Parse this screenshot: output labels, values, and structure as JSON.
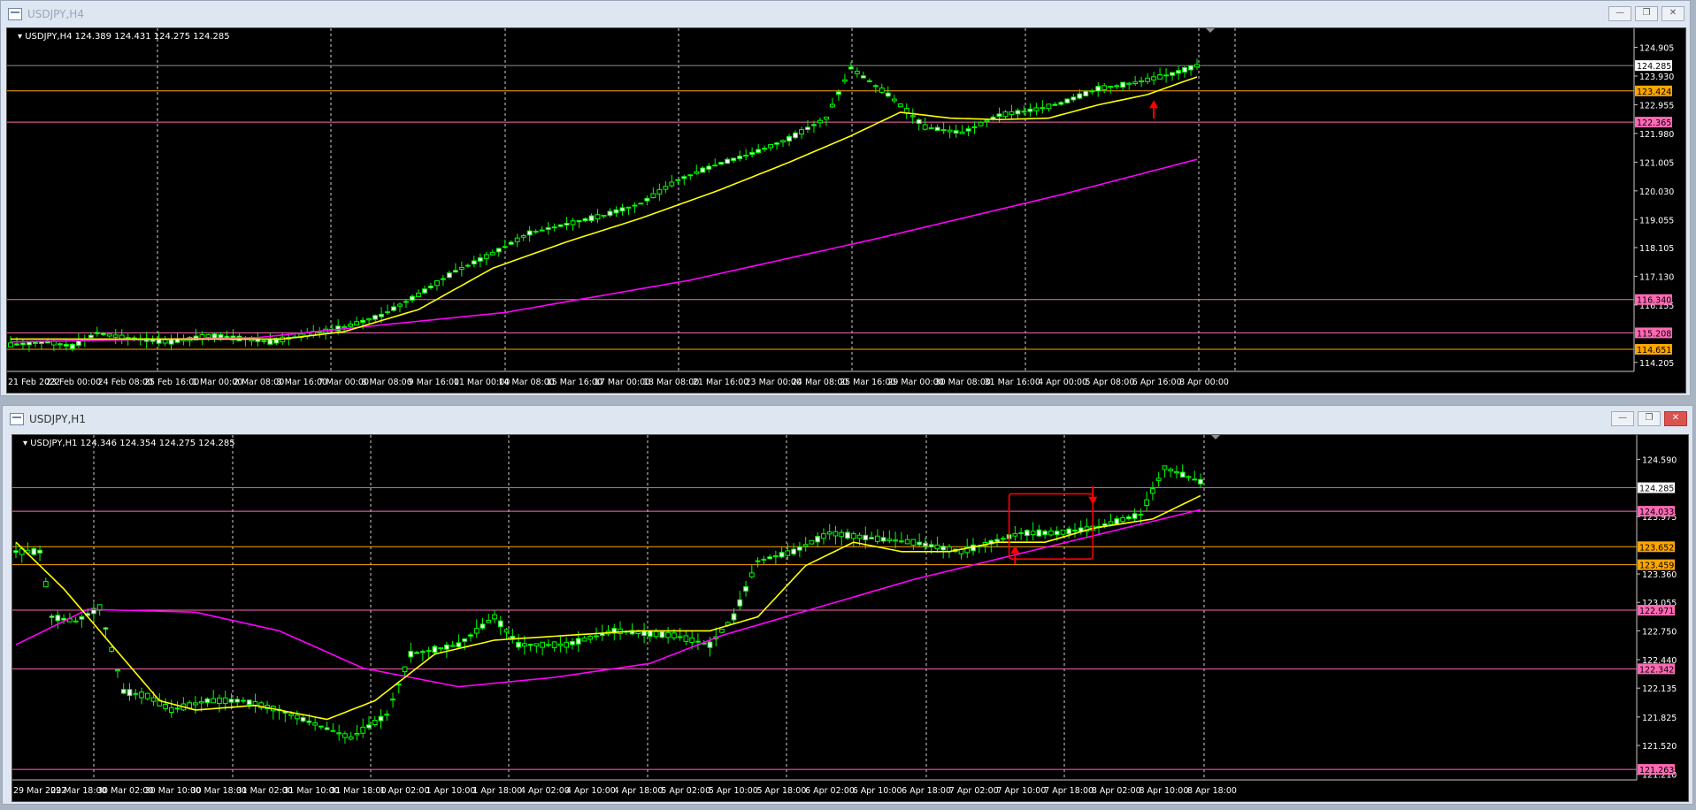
{
  "windows": [
    {
      "title": "USDJPY,H4",
      "buttons": [
        "minimize",
        "restore",
        "close"
      ]
    },
    {
      "title": "USDJPY,H1",
      "buttons": [
        "minimize",
        "restore",
        "close"
      ]
    }
  ],
  "colors": {
    "background": "#000000",
    "bull": "#00ff00",
    "ma_fast": "#ffff00",
    "ma_slow": "#ff00ff",
    "orange_level": "#ffa500",
    "pink_level": "#ff69b4",
    "arrow": "#ff0000"
  },
  "chart_data": [
    {
      "type": "candlestick",
      "header": "USDJPY,H4  124.389 124.431 124.275 124.285",
      "ylim": [
        113.9,
        125.55
      ],
      "y_ticks": [
        "124.905",
        "123.930",
        "122.955",
        "121.980",
        "121.005",
        "120.030",
        "119.055",
        "118.105",
        "117.130",
        "116.155",
        "114.205"
      ],
      "y_tick_values": [
        124.905,
        123.93,
        122.955,
        121.98,
        121.005,
        120.03,
        119.055,
        118.105,
        117.13,
        116.155,
        114.205
      ],
      "x_ticks": [
        "21 Feb 2022",
        "23 Feb 00:00",
        "24 Feb 08:00",
        "25 Feb 16:00",
        "1 Mar 00:00",
        "2 Mar 08:00",
        "3 Mar 16:00",
        "7 Mar 00:00",
        "8 Mar 08:00",
        "9 Mar 16:00",
        "11 Mar 00:00",
        "14 Mar 08:00",
        "15 Mar 16:00",
        "17 Mar 00:00",
        "18 Mar 08:00",
        "21 Mar 16:00",
        "23 Mar 00:00",
        "24 Mar 08:00",
        "25 Mar 16:00",
        "29 Mar 00:00",
        "30 Mar 08:00",
        "31 Mar 16:00",
        "4 Apr 00:00",
        "5 Apr 08:00",
        "6 Apr 16:00",
        "8 Apr 00:00"
      ],
      "price_curve": [
        [
          0,
          114.8
        ],
        [
          6,
          114.9
        ],
        [
          10,
          114.75
        ],
        [
          14,
          115.2
        ],
        [
          20,
          115.0
        ],
        [
          26,
          114.9
        ],
        [
          32,
          115.1
        ],
        [
          38,
          115.0
        ],
        [
          42,
          114.9
        ],
        [
          48,
          115.15
        ],
        [
          54,
          115.4
        ],
        [
          60,
          115.8
        ],
        [
          66,
          116.5
        ],
        [
          72,
          117.3
        ],
        [
          78,
          117.9
        ],
        [
          84,
          118.6
        ],
        [
          90,
          118.9
        ],
        [
          96,
          119.2
        ],
        [
          102,
          119.6
        ],
        [
          108,
          120.4
        ],
        [
          114,
          120.9
        ],
        [
          120,
          121.3
        ],
        [
          126,
          121.8
        ],
        [
          132,
          122.5
        ],
        [
          136,
          124.2
        ],
        [
          138,
          123.9
        ],
        [
          142,
          123.3
        ],
        [
          148,
          122.2
        ],
        [
          154,
          122.0
        ],
        [
          160,
          122.6
        ],
        [
          166,
          122.8
        ],
        [
          170,
          123.0
        ],
        [
          176,
          123.5
        ],
        [
          182,
          123.7
        ],
        [
          188,
          124.0
        ],
        [
          192,
          124.28
        ]
      ],
      "ma_fast": [
        [
          0,
          115.0
        ],
        [
          20,
          115.0
        ],
        [
          44,
          115.0
        ],
        [
          54,
          115.25
        ],
        [
          66,
          116.0
        ],
        [
          78,
          117.4
        ],
        [
          90,
          118.3
        ],
        [
          102,
          119.1
        ],
        [
          114,
          120.0
        ],
        [
          126,
          121.0
        ],
        [
          136,
          121.9
        ],
        [
          144,
          122.7
        ],
        [
          152,
          122.5
        ],
        [
          160,
          122.45
        ],
        [
          168,
          122.5
        ],
        [
          176,
          122.95
        ],
        [
          184,
          123.3
        ],
        [
          192,
          123.9
        ]
      ],
      "ma_slow": [
        [
          0,
          114.9
        ],
        [
          40,
          115.05
        ],
        [
          80,
          115.9
        ],
        [
          110,
          117.0
        ],
        [
          140,
          118.4
        ],
        [
          170,
          119.9
        ],
        [
          192,
          121.1
        ]
      ],
      "levels": [
        {
          "value": 124.285,
          "label": "124.285",
          "color": "#8c8c8c",
          "label_bg": "#ffffff",
          "label_fg": "#000000"
        },
        {
          "value": 123.424,
          "label": "123.424",
          "color": "#ffa500",
          "label_bg": "#ffa500",
          "label_fg": "#000000"
        },
        {
          "value": 122.365,
          "label": "122.365",
          "color": "#ff69b4",
          "label_bg": "#ff69b4",
          "label_fg": "#000000"
        },
        {
          "value": 116.34,
          "label": "116.340",
          "color": "#ff69b4",
          "label_bg": "#ff69b4",
          "label_fg": "#000000"
        },
        {
          "value": 115.208,
          "label": "115.208",
          "color": "#ff69b4",
          "label_bg": "#ff69b4",
          "label_fg": "#000000"
        },
        {
          "value": 114.651,
          "label": "114.651",
          "color": "#ffa500",
          "label_bg": "#ffa500",
          "label_fg": "#000000"
        }
      ],
      "arrows": [
        {
          "x": 185,
          "y": 122.9,
          "dir": "up"
        }
      ]
    },
    {
      "type": "candlestick",
      "header": "USDJPY,H1  124.346 124.354 124.275 124.285",
      "ylim": [
        121.15,
        124.85
      ],
      "y_ticks": [
        "124.590",
        "123.975",
        "123.360",
        "123.055",
        "122.750",
        "122.440",
        "122.135",
        "121.825",
        "121.520",
        "121.210"
      ],
      "y_tick_values": [
        124.59,
        123.975,
        123.36,
        123.055,
        122.75,
        122.44,
        122.135,
        121.825,
        121.52,
        121.21
      ],
      "x_ticks": [
        "29 Mar 2022",
        "29 Mar 18:00",
        "30 Mar 02:00",
        "30 Mar 10:00",
        "30 Mar 18:00",
        "31 Mar 02:00",
        "31 Mar 10:00",
        "31 Mar 18:00",
        "1 Apr 02:00",
        "1 Apr 10:00",
        "1 Apr 18:00",
        "4 Apr 02:00",
        "4 Apr 10:00",
        "4 Apr 18:00",
        "5 Apr 02:00",
        "5 Apr 10:00",
        "5 Apr 18:00",
        "6 Apr 02:00",
        "6 Apr 10:00",
        "6 Apr 18:00",
        "7 Apr 02:00",
        "7 Apr 10:00",
        "7 Apr 18:00",
        "8 Apr 02:00",
        "8 Apr 10:00",
        "8 Apr 18:00"
      ],
      "price_curve": [
        [
          0,
          123.6
        ],
        [
          4,
          123.6
        ],
        [
          6,
          122.9
        ],
        [
          10,
          122.85
        ],
        [
          14,
          123.0
        ],
        [
          18,
          122.1
        ],
        [
          22,
          122.05
        ],
        [
          26,
          121.9
        ],
        [
          32,
          122.0
        ],
        [
          38,
          122.0
        ],
        [
          44,
          121.9
        ],
        [
          52,
          121.7
        ],
        [
          56,
          121.6
        ],
        [
          62,
          121.85
        ],
        [
          66,
          122.5
        ],
        [
          74,
          122.6
        ],
        [
          80,
          122.9
        ],
        [
          84,
          122.6
        ],
        [
          92,
          122.6
        ],
        [
          100,
          122.75
        ],
        [
          110,
          122.7
        ],
        [
          116,
          122.6
        ],
        [
          120,
          122.9
        ],
        [
          124,
          123.5
        ],
        [
          130,
          123.6
        ],
        [
          136,
          123.8
        ],
        [
          142,
          123.75
        ],
        [
          150,
          123.7
        ],
        [
          158,
          123.6
        ],
        [
          168,
          123.8
        ],
        [
          174,
          123.8
        ],
        [
          180,
          123.85
        ],
        [
          188,
          124.0
        ],
        [
          192,
          124.5
        ],
        [
          198,
          124.35
        ]
      ],
      "ma_fast": [
        [
          0,
          123.7
        ],
        [
          8,
          123.2
        ],
        [
          16,
          122.6
        ],
        [
          24,
          122.0
        ],
        [
          30,
          121.9
        ],
        [
          40,
          121.95
        ],
        [
          52,
          121.8
        ],
        [
          60,
          122.0
        ],
        [
          70,
          122.5
        ],
        [
          80,
          122.65
        ],
        [
          92,
          122.7
        ],
        [
          104,
          122.75
        ],
        [
          116,
          122.75
        ],
        [
          124,
          122.9
        ],
        [
          132,
          123.45
        ],
        [
          140,
          123.7
        ],
        [
          148,
          123.6
        ],
        [
          156,
          123.6
        ],
        [
          164,
          123.7
        ],
        [
          172,
          123.7
        ],
        [
          180,
          123.85
        ],
        [
          190,
          123.95
        ],
        [
          198,
          124.2
        ]
      ],
      "ma_slow": [
        [
          0,
          122.6
        ],
        [
          12,
          122.98
        ],
        [
          30,
          122.95
        ],
        [
          44,
          122.75
        ],
        [
          58,
          122.35
        ],
        [
          74,
          122.15
        ],
        [
          90,
          122.25
        ],
        [
          106,
          122.4
        ],
        [
          118,
          122.7
        ],
        [
          134,
          123.0
        ],
        [
          150,
          123.3
        ],
        [
          166,
          123.55
        ],
        [
          182,
          123.8
        ],
        [
          198,
          124.05
        ]
      ],
      "levels": [
        {
          "value": 124.285,
          "label": "124.285",
          "color": "#8c8c8c",
          "label_bg": "#ffffff",
          "label_fg": "#000000"
        },
        {
          "value": 124.033,
          "label": "124.033",
          "color": "#ff69b4",
          "label_bg": "#ff69b4",
          "label_fg": "#000000"
        },
        {
          "value": 123.652,
          "label": "123.652",
          "color": "#ffa500",
          "label_bg": "#ffa500",
          "label_fg": "#000000"
        },
        {
          "value": 123.459,
          "label": "123.459",
          "color": "#ffa500",
          "label_bg": "#ffa500",
          "label_fg": "#000000"
        },
        {
          "value": 122.971,
          "label": "122.971",
          "color": "#ff69b4",
          "label_bg": "#ff69b4",
          "label_fg": "#000000"
        },
        {
          "value": 122.342,
          "label": "122.342",
          "color": "#ff69b4",
          "label_bg": "#ff69b4",
          "label_fg": "#000000"
        },
        {
          "value": 121.263,
          "label": "121.263",
          "color": "#ff69b4",
          "label_bg": "#ff69b4",
          "label_fg": "#000000"
        }
      ],
      "box": {
        "x0": 166,
        "x1": 180,
        "y0": 123.52,
        "y1": 124.22
      },
      "arrows": [
        {
          "x": 167,
          "y": 123.6,
          "dir": "up"
        },
        {
          "x": 180,
          "y": 124.15,
          "dir": "down"
        }
      ]
    }
  ]
}
